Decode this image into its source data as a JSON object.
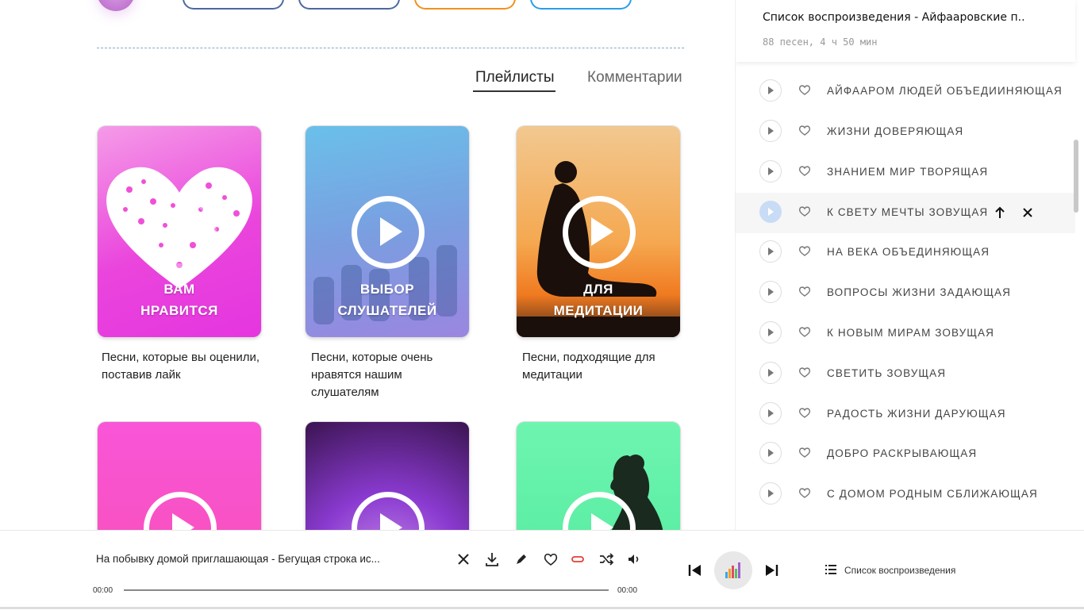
{
  "tabs": {
    "playlists": "Плейлисты",
    "comments": "Комментарии"
  },
  "cards": [
    {
      "title": "ВАМ\nНРАВИТСЯ",
      "description": "Песни, которые вы оценили, поставив лайк"
    },
    {
      "title": "ВЫБОР\nСЛУШАТЕЛЕЙ",
      "description": "Песни, которые очень нравятся нашим слушателям"
    },
    {
      "title": "ДЛЯ\nМЕДИТАЦИИ",
      "description": "Песни, подходящие для медитации"
    }
  ],
  "playlist_panel": {
    "title": "Список воспроизведения - Айфааровские п..",
    "subtitle": "88 песен, 4 ч 50 мин",
    "tracks": [
      "АЙФААРОМ ЛЮДЕЙ ОБЪЕДИИНЯЮЩАЯ",
      "ЖИЗНИ ДОВЕРЯЮЩАЯ",
      "ЗНАНИЕМ МИР ТВОРЯЩАЯ",
      "К СВЕТУ МЕЧТЫ ЗОВУЩАЯ",
      "НА ВЕКА ОБЪЕДИНЯЮЩАЯ",
      "ВОПРОСЫ ЖИЗНИ ЗАДАЮЩАЯ",
      "К НОВЫМ МИРАМ ЗОВУЩАЯ",
      "СВЕТИТЬ ЗОВУЩАЯ",
      "РАДОСТЬ ЖИЗНИ ДАРУЮЩАЯ",
      "ДОБРО РАСКРЫВАЮЩАЯ",
      "С ДОМОМ РОДНЫМ СБЛИЖАЮЩАЯ"
    ],
    "active_track_index": 3
  },
  "player": {
    "now_playing": "На побывку домой приглашающая  - Бегущая строка ис...",
    "time_current": "00:00",
    "time_total": "00:00",
    "progress": 0,
    "playlist_button_label": "Список  воспроизведения"
  },
  "colors": {
    "accent_repeat": "#e0413a",
    "active_play": "#c9dcf5"
  },
  "icons": [
    "close-icon",
    "download-icon",
    "pen-icon",
    "heart-icon",
    "repeat-icon",
    "shuffle-icon",
    "volume-icon",
    "previous-icon",
    "equalizer-icon",
    "next-icon",
    "list-icon",
    "play-icon",
    "arrow-up-icon"
  ]
}
